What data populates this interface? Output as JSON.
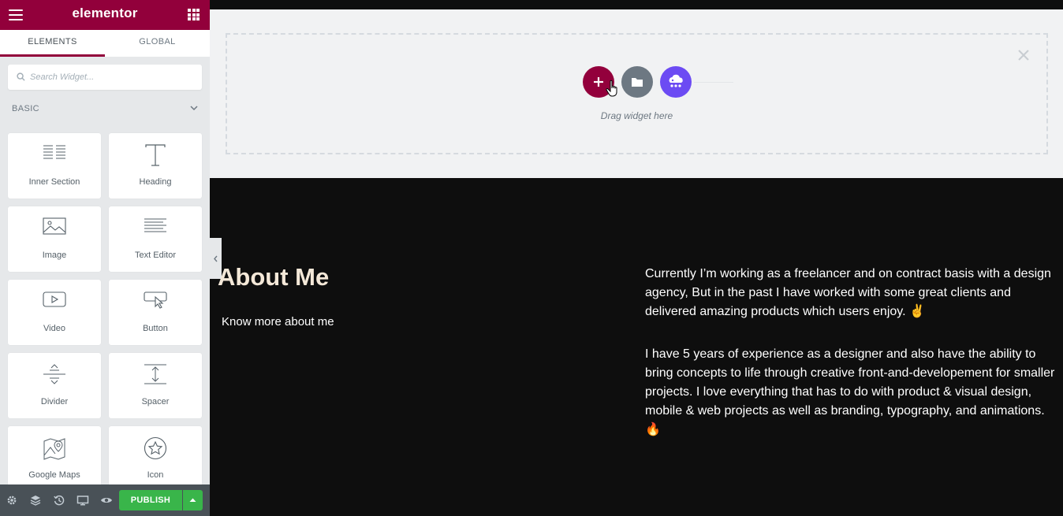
{
  "app": {
    "brand": "elementor"
  },
  "sidebar": {
    "tabs": [
      {
        "label": "ELEMENTS",
        "active": true
      },
      {
        "label": "GLOBAL",
        "active": false
      }
    ],
    "search": {
      "placeholder": "Search Widget..."
    },
    "category": "BASIC",
    "widgets": [
      {
        "label": "Inner Section",
        "icon": "inner-section-icon"
      },
      {
        "label": "Heading",
        "icon": "heading-icon"
      },
      {
        "label": "Image",
        "icon": "image-icon"
      },
      {
        "label": "Text Editor",
        "icon": "text-editor-icon"
      },
      {
        "label": "Video",
        "icon": "video-icon"
      },
      {
        "label": "Button",
        "icon": "button-icon"
      },
      {
        "label": "Divider",
        "icon": "divider-icon"
      },
      {
        "label": "Spacer",
        "icon": "spacer-icon"
      },
      {
        "label": "Google Maps",
        "icon": "google-maps-icon"
      },
      {
        "label": "Icon",
        "icon": "star-icon"
      }
    ],
    "footer": {
      "icons": [
        "settings-icon",
        "layers-icon",
        "history-icon",
        "responsive-icon",
        "preview-icon"
      ],
      "publish_label": "PUBLISH"
    }
  },
  "canvas": {
    "dropzone": {
      "hint": "Drag widget here"
    },
    "about": {
      "heading": "About Me",
      "subheading": "Know more about me",
      "paragraphs": [
        "Currently I’m working as a freelancer and on contract basis with a design agency, But in the past I have worked with some great clients and delivered amazing products which users enjoy. ✌️",
        "I have 5 years of experience as a designer and also have the ability to bring concepts to life through creative front-and-developement for smaller projects. I love everything that has to do with product & visual design, mobile & web projects as well as branding, typography, and animations. 🔥"
      ]
    }
  },
  "colors": {
    "brand": "#92003b",
    "publish": "#39b54a",
    "kit": "#6c4bf3",
    "folder": "#6d7882",
    "heading": "#f4e8d8"
  }
}
